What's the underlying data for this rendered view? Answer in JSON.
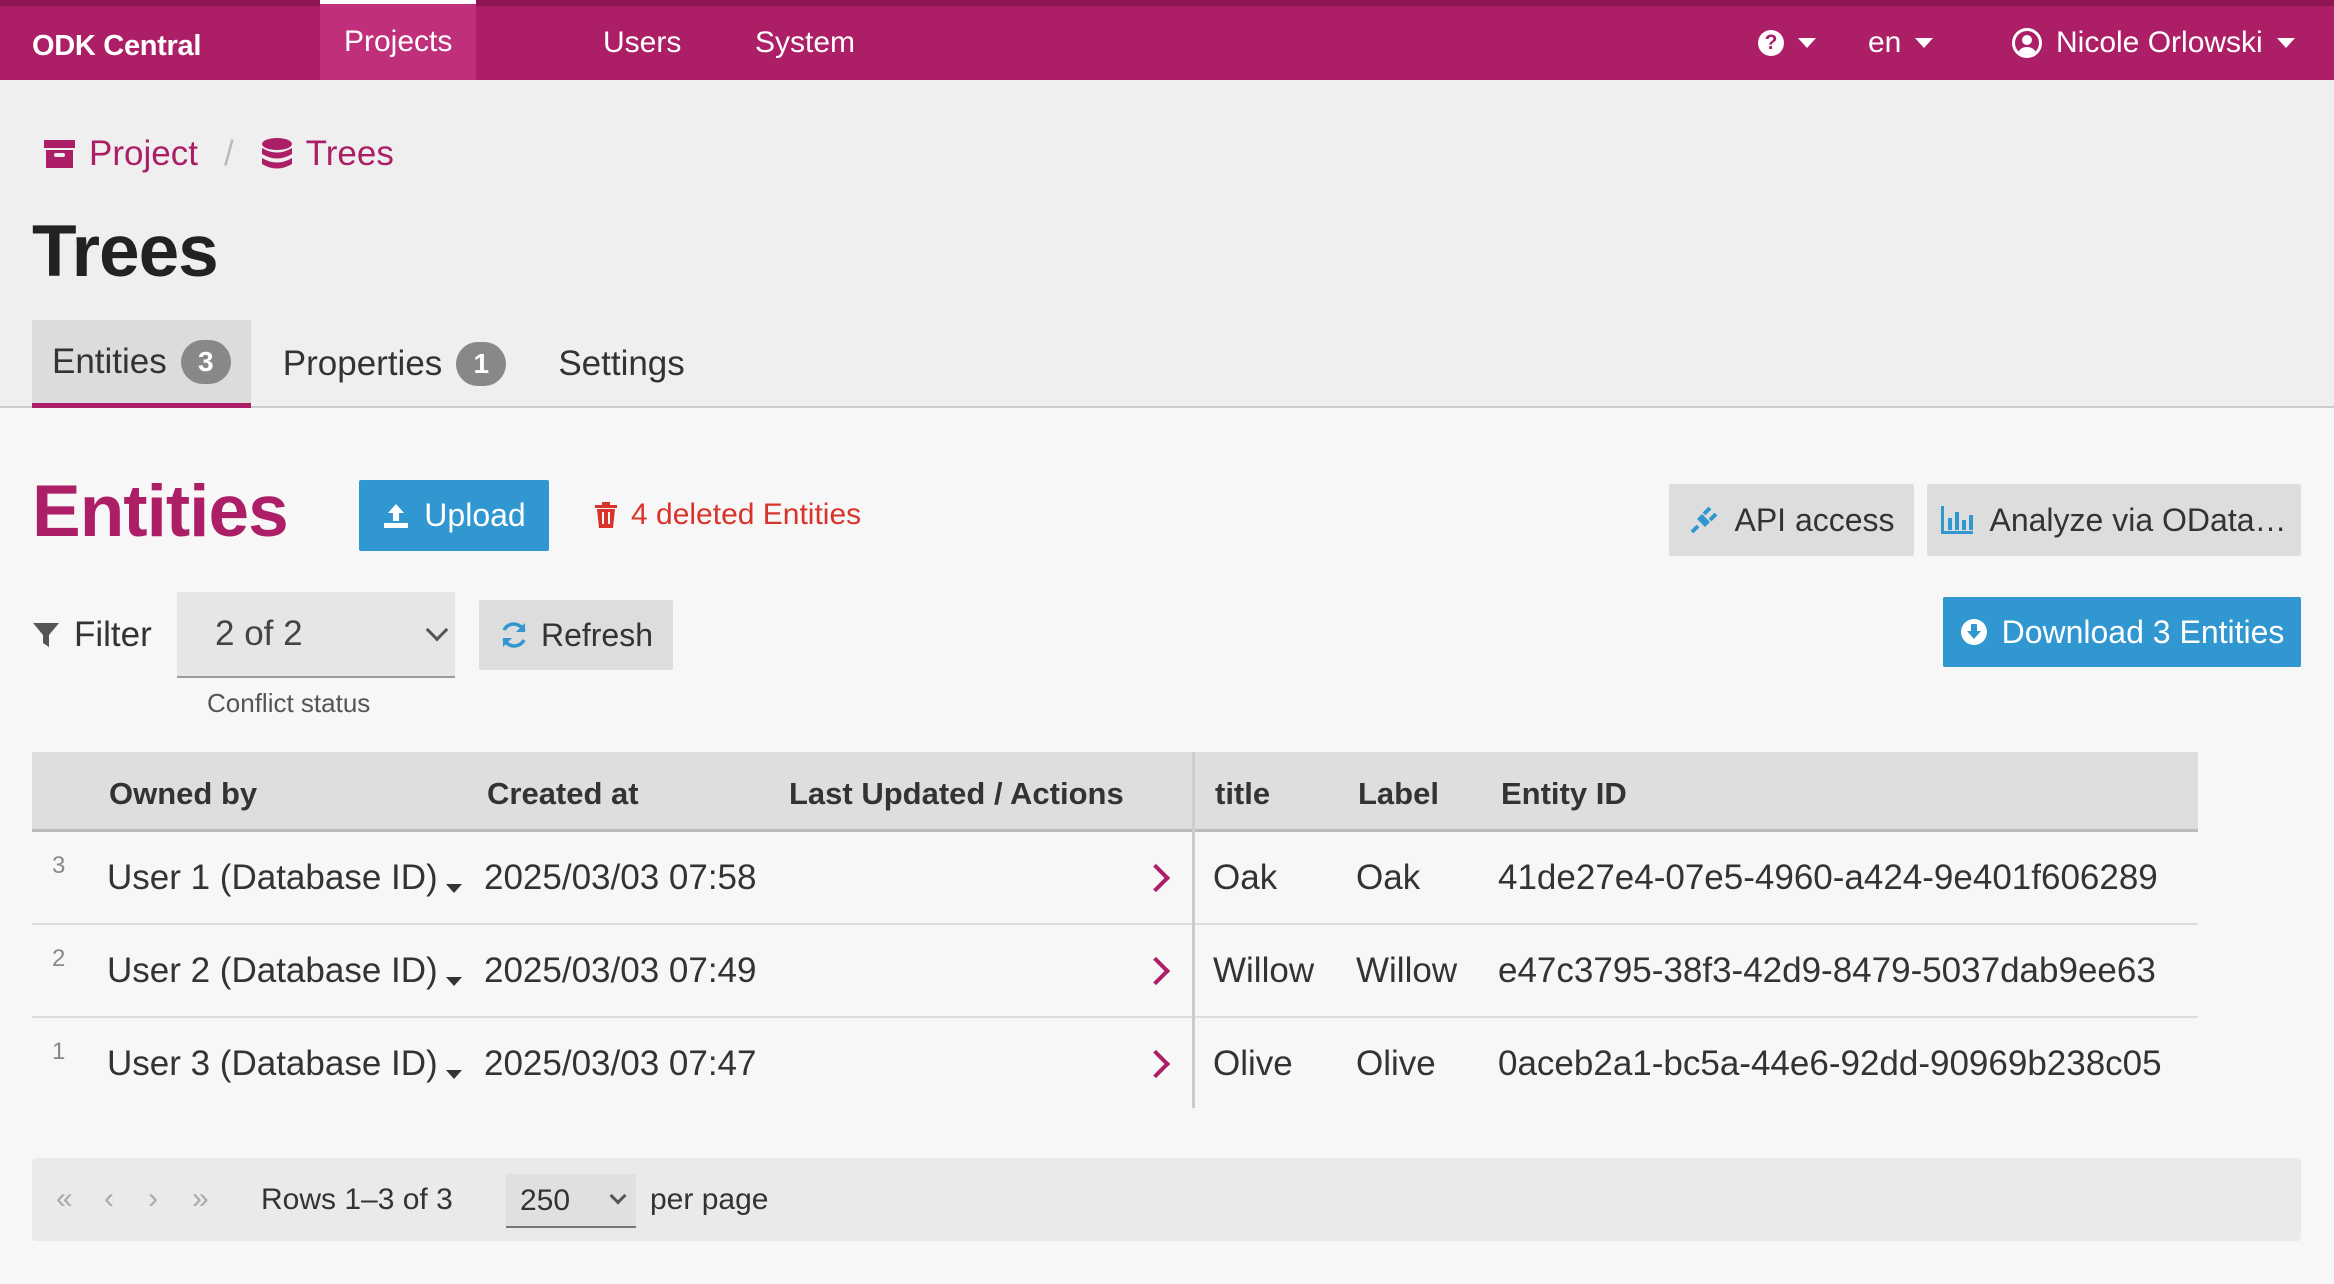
{
  "navbar": {
    "brand": "ODK Central",
    "links": [
      "Projects",
      "Users",
      "System"
    ],
    "help_symbol": "?",
    "language": "en",
    "user_name": "Nicole Orlowski"
  },
  "breadcrumb": {
    "project": "Project",
    "dataset": "Trees"
  },
  "page_title": "Trees",
  "tabs": [
    {
      "label": "Entities",
      "count": "3"
    },
    {
      "label": "Properties",
      "count": "1"
    },
    {
      "label": "Settings"
    }
  ],
  "entities": {
    "title": "Entities",
    "upload_label": "Upload",
    "deleted_label": "4 deleted Entities",
    "api_access_label": "API access",
    "analyze_label": "Analyze via OData…",
    "download_label": "Download 3 Entities"
  },
  "filter": {
    "label": "Filter",
    "value": "2 of 2",
    "help": "Conflict status",
    "refresh_label": "Refresh"
  },
  "table": {
    "headers": [
      "Owned by",
      "Created at",
      "Last Updated / Actions",
      "title",
      "Label",
      "Entity ID"
    ],
    "rows": [
      {
        "num": "3",
        "owner": "User 1 (Database ID)",
        "created": "2025/03/03 07:58",
        "title": "Oak",
        "label": "Oak",
        "id": "41de27e4-07e5-4960-a424-9e401f606289"
      },
      {
        "num": "2",
        "owner": "User 2 (Database ID)",
        "created": "2025/03/03 07:49",
        "title": "Willow",
        "label": "Willow",
        "id": "e47c3795-38f3-42d9-8479-5037dab9ee63"
      },
      {
        "num": "1",
        "owner": "User 3 (Database ID)",
        "created": "2025/03/03 07:47",
        "title": "Olive",
        "label": "Olive",
        "id": "0aceb2a1-bc5a-44e6-92dd-90969b238c05"
      }
    ]
  },
  "pagination": {
    "first": "«",
    "prev": "‹",
    "next": "›",
    "last": "»",
    "rows_label": "Rows 1–3 of 3",
    "per_page_value": "250",
    "per_page_label": "per page"
  },
  "colors": {
    "brand": "#ac1f66",
    "primary": "#3097d1",
    "danger": "#d9342c"
  }
}
